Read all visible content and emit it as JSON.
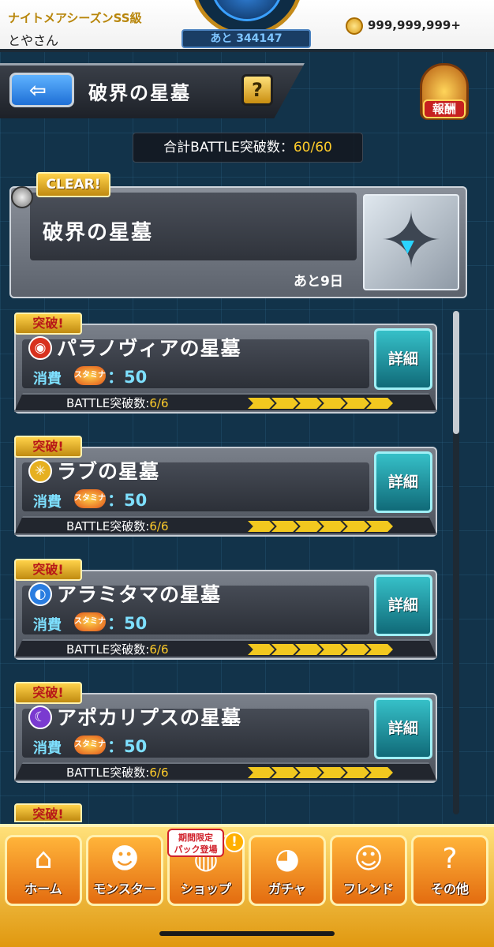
{
  "header": {
    "season": "ナイトメアシーズンSS級",
    "username": "とやさん",
    "remaining": "あと 344147",
    "coins": "999,999,999+"
  },
  "titlebar": {
    "back_icon": "left-arrow-icon",
    "title": "破界の星墓",
    "help": "?",
    "reward_label": "報酬"
  },
  "summary": {
    "label": "合計BATTLE突破数：",
    "value": "60/60"
  },
  "clear_card": {
    "tag": "CLEAR!",
    "name": "破界の星墓",
    "days_left": "あと9日",
    "emblem_icon": "star-emblem-icon"
  },
  "quests": [
    {
      "tag": "突破!",
      "element": "fire",
      "element_glyph": "◉",
      "element_color": "#d8321e",
      "name": "パラノヴィアの星墓",
      "cost_label": "消費",
      "stamina": "スタミナ",
      "cost": "：50",
      "detail": "詳細",
      "battle_label": "BATTLE突破数:",
      "battle_value": "6/6",
      "progress": 1.0
    },
    {
      "tag": "突破!",
      "element": "light",
      "element_glyph": "✳",
      "element_color": "#e6b020",
      "name": "ラブの星墓",
      "cost_label": "消費",
      "stamina": "スタミナ",
      "cost": "：50",
      "detail": "詳細",
      "battle_label": "BATTLE突破数:",
      "battle_value": "6/6",
      "progress": 1.0
    },
    {
      "tag": "突破!",
      "element": "water",
      "element_glyph": "◐",
      "element_color": "#2a7de0",
      "name": "アラミタマの星墓",
      "cost_label": "消費",
      "stamina": "スタミナ",
      "cost": "：50",
      "detail": "詳細",
      "battle_label": "BATTLE突破数:",
      "battle_value": "6/6",
      "progress": 1.0
    },
    {
      "tag": "突破!",
      "element": "dark",
      "element_glyph": "☾",
      "element_color": "#7a3ad0",
      "name": "アポカリプスの星墓",
      "cost_label": "消費",
      "stamina": "スタミナ",
      "cost": "：50",
      "detail": "詳細",
      "battle_label": "BATTLE突破数:",
      "battle_value": "6/6",
      "progress": 1.0
    }
  ],
  "peek": {
    "tag": "突破!"
  },
  "nav": [
    {
      "label": "ホーム",
      "icon": "home-icon",
      "glyph": "⌂"
    },
    {
      "label": "モンスター",
      "icon": "monster-icon",
      "glyph": "☻"
    },
    {
      "label": "ショップ",
      "icon": "shop-icon",
      "glyph": "◍"
    },
    {
      "label": "ガチャ",
      "icon": "gacha-icon",
      "glyph": "◕"
    },
    {
      "label": "フレンド",
      "icon": "friend-icon",
      "glyph": "☺"
    },
    {
      "label": "その他",
      "icon": "other-icon",
      "glyph": "?"
    }
  ],
  "shop_badge": {
    "line1": "期間限定",
    "line2": "パック登場",
    "alert": "!"
  }
}
